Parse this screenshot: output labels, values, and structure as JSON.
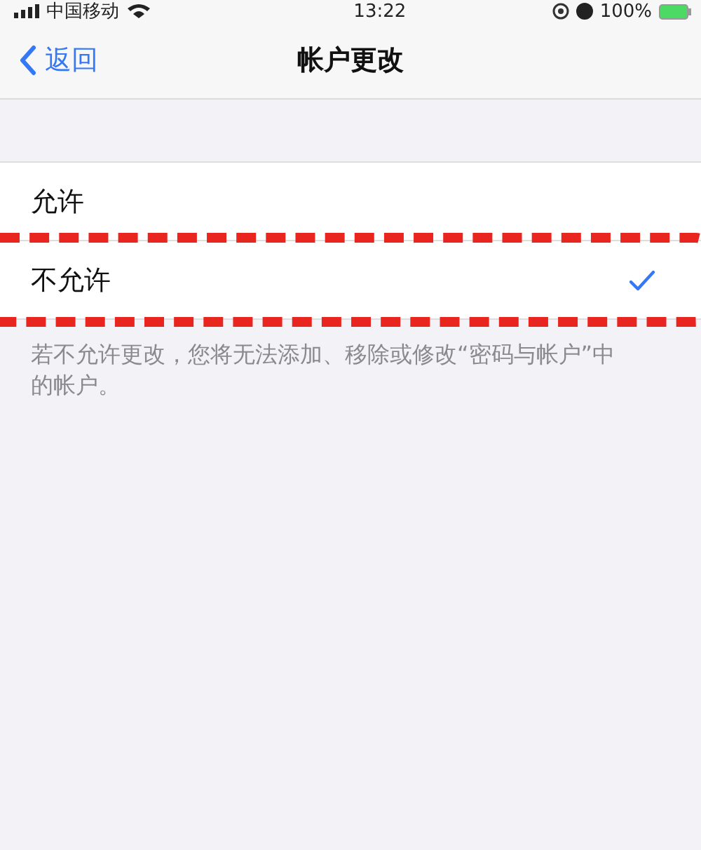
{
  "status_bar": {
    "carrier": "中国移动",
    "time": "13:22",
    "battery": "100%"
  },
  "nav": {
    "back": "返回",
    "title": "帐户更改"
  },
  "options": [
    {
      "label": "允许",
      "selected": false
    },
    {
      "label": "不允许",
      "selected": true,
      "highlighted": true
    }
  ],
  "footer": "若不允许更改，您将无法添加、移除或修改“密码与帐户”中的帐户。"
}
